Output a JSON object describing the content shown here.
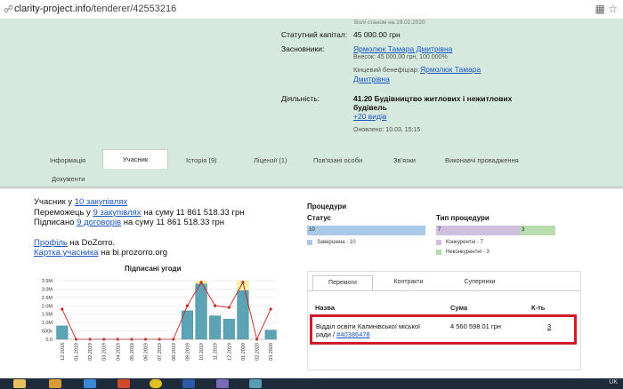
{
  "browser": {
    "url_host": "clarity-project.info",
    "url_path": "/tenderer/42553216"
  },
  "header": {
    "top_partial": "Волі станом на 19.02.2020",
    "capital_label": "Статутний капітал:",
    "capital_value": "45 000.00 грн",
    "founders_label": "Засновники:",
    "founder_name": "Ярмолюк Тамара Дмитрівна",
    "founder_contribution": "Внесок: 45 000.00 грн, 100.000%",
    "beneficiary_label": "Кінцевий бенефіціар:",
    "beneficiary_name_1": "Ярмолюк Тамара",
    "beneficiary_name_2": "Дмитрівна",
    "activity_label": "Діяльність:",
    "activity_line1": "41.20 Будівництво житлових і нежитлових",
    "activity_line2": "будівель",
    "activity_more": "+20 видів",
    "updated": "Оновлено: 10.03, 15:15"
  },
  "tabs": [
    {
      "label": "Інформація"
    },
    {
      "label": "Учасник"
    },
    {
      "label": "Історія (9)"
    },
    {
      "label": "Ліцензії (1)"
    },
    {
      "label": "Пов'язані особи"
    },
    {
      "label": "Зв'язки"
    },
    {
      "label": "Виконавчі провадження"
    },
    {
      "label": "Документи"
    }
  ],
  "summary": {
    "l1_prefix": "Учасник у ",
    "l1_link": "10 закупівлях",
    "l2_prefix": "Переможець у ",
    "l2_link": "9 закупівлях",
    "l2_suffix": " на суму 11 861 518.33 грн",
    "l3_prefix": "Підписано ",
    "l3_link": "9 договорів",
    "l3_suffix": " на суму 11 861 518.33 грн",
    "l4_link": "Профіль",
    "l4_suffix": " на DoZorro.",
    "l5_link": "Картка учасника",
    "l5_suffix": " на bi.prozorro.org"
  },
  "chart_data": {
    "type": "bar",
    "title": "Підписані угоди",
    "categories": [
      "12.2018",
      "01.2019",
      "02.2019",
      "03.2019",
      "04.2019",
      "05.2019",
      "06.2019",
      "07.2019",
      "08.2019",
      "09.2019",
      "10.2019",
      "11.2019",
      "12.2019",
      "01.2020",
      "02.2020",
      "03.2020"
    ],
    "values": [
      0.8,
      0,
      0,
      0,
      0,
      0,
      0,
      0,
      0,
      1.7,
      3.3,
      1.4,
      1.2,
      2.9,
      0,
      0.55
    ],
    "line_values": [
      1.8,
      0,
      0,
      0,
      0,
      0,
      0,
      0,
      0,
      2.0,
      3.4,
      2.0,
      1.9,
      3.4,
      0,
      1.8
    ],
    "y_ticks": [
      "3.5M",
      "3.0M",
      "2.5M",
      "2.0M",
      "1.5M",
      "1.0M",
      "500k",
      "0.0"
    ],
    "ylim": [
      0,
      3.5
    ],
    "highlight_indices": [
      10,
      13
    ],
    "bar_color": "#5ba3b5",
    "highlight_color": "#f2f0a0",
    "line_color": "#cc2222"
  },
  "procedures": {
    "title": "Процедури",
    "status_title": "Статус",
    "status_bar_value": "10",
    "status_legend": "Завершена - 10",
    "type_title": "Тип процедури",
    "type_bar_value_1": "7",
    "type_bar_value_2": "3",
    "type_legend_1": "Конкурентні - 7",
    "type_legend_2": "Неконкурентні - 3",
    "colors": {
      "status": "#aac8e8",
      "competitive": "#cfc0e0",
      "noncompetitive": "#b8dcb0"
    }
  },
  "panel": {
    "tabs": [
      "Перемоги",
      "Контракти",
      "Суперники"
    ],
    "col_name": "Назва",
    "col_sum": "Сума",
    "col_count": "К-ть",
    "row": {
      "name_line1": "Відділ освіти Калинівської міської",
      "name_line2_prefix": "ради / ",
      "name_code": "#40386478",
      "sum": "4 560 598.01 грн",
      "count": "3"
    }
  },
  "taskbar": {
    "lang": "UK",
    "icons": [
      "explorer-icon",
      "media-icon",
      "ie-icon",
      "powerpoint-icon",
      "chrome-icon",
      "word-icon",
      "app-icon",
      "app-icon-2"
    ]
  }
}
